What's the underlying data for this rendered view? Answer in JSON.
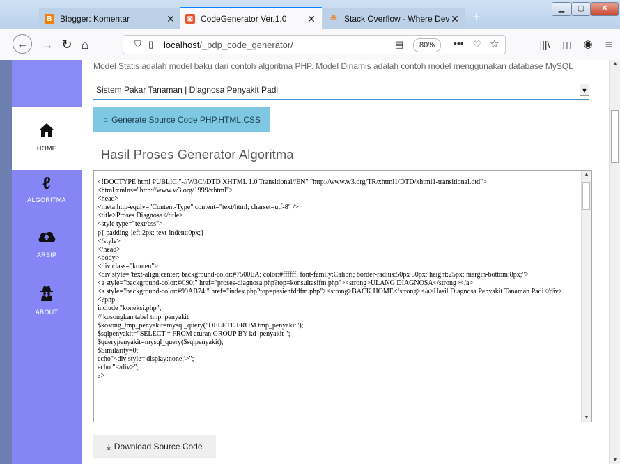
{
  "browser": {
    "tabs": [
      {
        "label": "Blogger: Komentar",
        "favicon": "blogger-icon",
        "active": false
      },
      {
        "label": "CodeGenerator Ver.1.0",
        "favicon": "codegen-icon",
        "active": true
      },
      {
        "label": "Stack Overflow - Where Develo",
        "favicon": "stackoverflow-icon",
        "active": false
      }
    ],
    "url_host": "localhost",
    "url_path": "/_pdp_code_generator/",
    "zoom": "80%"
  },
  "sidebar": {
    "items": [
      {
        "label": "HOME",
        "icon": "home-icon",
        "active": true
      },
      {
        "label": "ALGORITMA",
        "icon": "branch-icon",
        "active": false
      },
      {
        "label": "ARSIP",
        "icon": "cloud-upload-icon",
        "active": false
      },
      {
        "label": "ABOUT",
        "icon": "user-secret-icon",
        "active": false
      }
    ]
  },
  "main": {
    "info": "Model Statis adalah model baku dari contoh algoritma PHP. Model Dinamis adalah contoh model menggunakan database MySQL",
    "select_value": "Sistem Pakar Tanaman | Diagnosa Penyakit Padi",
    "generate_label": "Generate Source Code PHP,HTML,CSS",
    "result_title": "Hasil Proses Generator Algoritma",
    "code": "<!DOCTYPE html PUBLIC \"-//W3C//DTD XHTML 1.0 Transitional//EN\" \"http://www.w3.org/TR/xhtml1/DTD/xhtml1-transitional.dtd\">\n<html xmlns=\"http://www.w3.org/1999/xhtml\">\n<head>\n<meta http-equiv=\"Content-Type\" content=\"text/html; charset=utf-8\" />\n<title>Proses Diagnosa</title>\n<style type=\"text/css\">\np{ padding-left:2px; text-indent:0px;}\n</style>\n</head>\n<body>\n<div class=\"konten\">\n<div style=\"text-align:center; background-color:#7500EA; color:#ffffff; font-family:Calibri; border-radius:50px 50px; height:25px; margin-bottom:8px;\">\n<a style=\"background-color:#C90;\" href=\"proses-diagnosa.php?top=konsultasifm.php\"><strong>ULANG DIAGNOSA</strong></a>\n<a style=\"background-color:#99AB74;\" href=\"index.php?top=pasienfddfm.php\"><strong>BACK HOME</strong></a>Hasil Diagnosa Penyakit Tanaman Padi</div>\n<?php\ninclude \"koneksi.php\";\n// kosongkan tabel tmp_penyakit\n$kosong_tmp_penyakit=mysql_query(\"DELETE FROM tmp_penyakit\");\n$sqlpenyakit=\"SELECT * FROM aturan GROUP BY kd_penyakit \";\n$querypenyakit=mysql_query($sqlpenyakit);\n$Similarity=0;\necho\"<div style='display:none;'>\";\necho \"</div>\";\n?>",
    "download_label": "Download Source Code"
  }
}
